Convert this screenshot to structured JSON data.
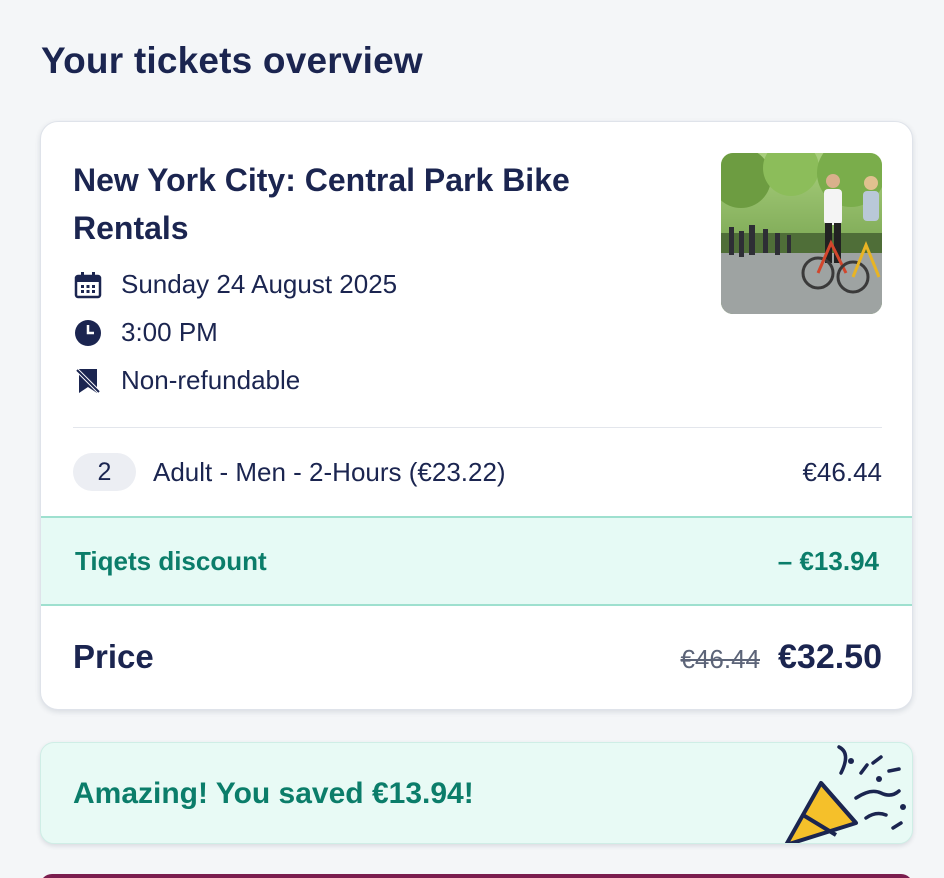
{
  "page": {
    "title": "Your tickets overview"
  },
  "ticket": {
    "product_title": "New York City: Central Park Bike Rentals",
    "date": "Sunday 24 August 2025",
    "time": "3:00 PM",
    "refund_policy": "Non-refundable",
    "line_item": {
      "quantity": "2",
      "label": "Adult - Men - 2-Hours (€23.22)",
      "price": "€46.44"
    },
    "discount": {
      "label": "Tiqets discount",
      "amount": "– €13.94"
    },
    "price": {
      "label": "Price",
      "original": "€46.44",
      "final": "€32.50"
    }
  },
  "savings": {
    "message": "Amazing! You saved €13.94!"
  },
  "icons": {
    "date": "calendar-icon",
    "time": "clock-icon",
    "refund": "non-refundable-icon",
    "savings": "party-popper-icon"
  },
  "colors": {
    "primary_text": "#1b2550",
    "discount_green": "#0b7d6a",
    "discount_bg": "#e6faf5",
    "accent_yellow": "#f5c02a"
  }
}
